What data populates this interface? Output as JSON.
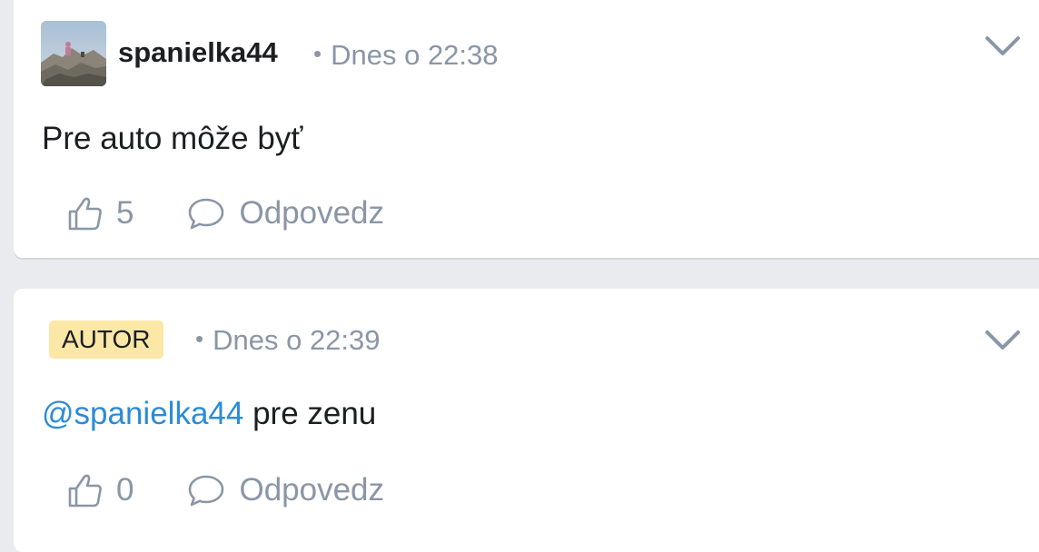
{
  "comments": [
    {
      "author": "spanielka44",
      "time": "Dnes o 22:38",
      "text": "Pre auto môže byť",
      "likes": "5",
      "reply_label": "Odpovedz",
      "icons": {
        "avatar": "user-avatar",
        "like": "thumbs-up-icon",
        "reply": "speech-bubble-icon",
        "menu": "chevron-down-icon"
      }
    },
    {
      "badge": "AUTOR",
      "time": "Dnes o 22:39",
      "mention": "@spanielka44",
      "text": " pre zenu",
      "likes": "0",
      "reply_label": "Odpovedz",
      "icons": {
        "like": "thumbs-up-icon",
        "reply": "speech-bubble-icon",
        "menu": "chevron-down-icon"
      }
    }
  ],
  "separator": "•",
  "colors": {
    "background": "#e9ebee",
    "card": "#ffffff",
    "text": "#1c1e21",
    "muted": "#8a96a6",
    "mention": "#2b8bd9",
    "badge": "#fbe7a6"
  }
}
